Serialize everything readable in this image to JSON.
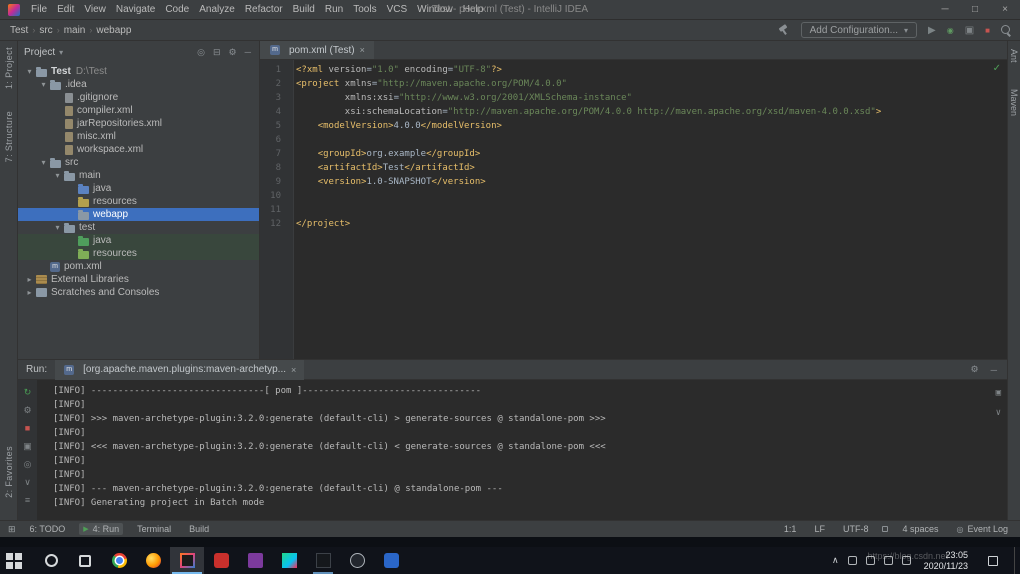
{
  "title_bar": {
    "menus": [
      "File",
      "Edit",
      "View",
      "Navigate",
      "Code",
      "Analyze",
      "Refactor",
      "Build",
      "Run",
      "Tools",
      "VCS",
      "Window",
      "Help"
    ],
    "title": "Test - pom.xml (Test) - IntelliJ IDEA"
  },
  "toolbar": {
    "breadcrumbs": [
      "Test",
      "src",
      "main",
      "webapp"
    ],
    "add_configuration": "Add Configuration..."
  },
  "left_stripe": {
    "top": [
      "1: Project",
      "7: Structure"
    ],
    "bottom": [
      "2: Favorites"
    ]
  },
  "right_stripe": {
    "top": [
      "Ant",
      "Maven"
    ]
  },
  "project_panel": {
    "header": "Project",
    "tree": [
      {
        "indent": 0,
        "chev": "down",
        "icon": "project-folder",
        "label": "Test",
        "extra": "D:\\Test",
        "bold": true
      },
      {
        "indent": 1,
        "chev": "down",
        "icon": "folder",
        "label": ".idea"
      },
      {
        "indent": 2,
        "chev": "none",
        "icon": "gitignore-file",
        "label": ".gitignore"
      },
      {
        "indent": 2,
        "chev": "none",
        "icon": "xml-file",
        "label": "compiler.xml"
      },
      {
        "indent": 2,
        "chev": "none",
        "icon": "xml-file",
        "label": "jarRepositories.xml"
      },
      {
        "indent": 2,
        "chev": "none",
        "icon": "xml-file",
        "label": "misc.xml"
      },
      {
        "indent": 2,
        "chev": "none",
        "icon": "xml-file",
        "label": "workspace.xml"
      },
      {
        "indent": 1,
        "chev": "down",
        "icon": "folder",
        "label": "src"
      },
      {
        "indent": 2,
        "chev": "down",
        "icon": "folder",
        "label": "main"
      },
      {
        "indent": 3,
        "chev": "none",
        "icon": "source-folder",
        "label": "java"
      },
      {
        "indent": 3,
        "chev": "none",
        "icon": "resources-folder",
        "label": "resources"
      },
      {
        "indent": 3,
        "chev": "none",
        "icon": "folder",
        "label": "webapp",
        "sel": "blue"
      },
      {
        "indent": 2,
        "chev": "down",
        "icon": "folder",
        "label": "test"
      },
      {
        "indent": 3,
        "chev": "none",
        "icon": "test-folder",
        "label": "java",
        "testbg": true
      },
      {
        "indent": 3,
        "chev": "none",
        "icon": "test-resources-folder",
        "label": "resources",
        "testbg": true
      },
      {
        "indent": 1,
        "chev": "none",
        "icon": "maven-file",
        "label": "pom.xml"
      },
      {
        "indent": 0,
        "chev": "right",
        "icon": "libraries",
        "label": "External Libraries"
      },
      {
        "indent": 0,
        "chev": "right",
        "icon": "scratches",
        "label": "Scratches and Consoles"
      }
    ]
  },
  "editor": {
    "tab_label": "pom.xml (Test)",
    "lines": [
      {
        "n": 1,
        "segs": [
          {
            "c": "tag",
            "t": "<?xml "
          },
          {
            "c": "attr",
            "t": "version"
          },
          {
            "c": "plain",
            "t": "="
          },
          {
            "c": "str",
            "t": "\"1.0\""
          },
          {
            "c": "plain",
            "t": " "
          },
          {
            "c": "attr",
            "t": "encoding"
          },
          {
            "c": "plain",
            "t": "="
          },
          {
            "c": "str",
            "t": "\"UTF-8\""
          },
          {
            "c": "tag",
            "t": "?>"
          }
        ]
      },
      {
        "n": 2,
        "segs": [
          {
            "c": "tag",
            "t": "<project "
          },
          {
            "c": "attr",
            "t": "xmlns"
          },
          {
            "c": "plain",
            "t": "="
          },
          {
            "c": "str",
            "t": "\"http://maven.apache.org/POM/4.0.0\""
          }
        ]
      },
      {
        "n": 3,
        "segs": [
          {
            "c": "plain",
            "t": "         "
          },
          {
            "c": "attr",
            "t": "xmlns:xsi"
          },
          {
            "c": "plain",
            "t": "="
          },
          {
            "c": "str",
            "t": "\"http://www.w3.org/2001/XMLSchema-instance\""
          }
        ]
      },
      {
        "n": 4,
        "segs": [
          {
            "c": "plain",
            "t": "         "
          },
          {
            "c": "attr",
            "t": "xsi:schemaLocation"
          },
          {
            "c": "plain",
            "t": "="
          },
          {
            "c": "str",
            "t": "\"http://maven.apache.org/POM/4.0.0 http://maven.apache.org/xsd/maven-4.0.0.xsd\""
          },
          {
            "c": "tag",
            "t": ">"
          }
        ]
      },
      {
        "n": 5,
        "segs": [
          {
            "c": "plain",
            "t": "    "
          },
          {
            "c": "tag",
            "t": "<modelVersion>"
          },
          {
            "c": "plain",
            "t": "4.0.0"
          },
          {
            "c": "tag",
            "t": "</modelVersion>"
          }
        ]
      },
      {
        "n": 6,
        "segs": []
      },
      {
        "n": 7,
        "segs": [
          {
            "c": "plain",
            "t": "    "
          },
          {
            "c": "tag",
            "t": "<groupId>"
          },
          {
            "c": "plain",
            "t": "org.example"
          },
          {
            "c": "tag",
            "t": "</groupId>"
          }
        ]
      },
      {
        "n": 8,
        "segs": [
          {
            "c": "plain",
            "t": "    "
          },
          {
            "c": "tag",
            "t": "<artifactId>"
          },
          {
            "c": "plain",
            "t": "Test"
          },
          {
            "c": "tag",
            "t": "</artifactId>"
          }
        ]
      },
      {
        "n": 9,
        "segs": [
          {
            "c": "plain",
            "t": "    "
          },
          {
            "c": "tag",
            "t": "<version>"
          },
          {
            "c": "plain",
            "t": "1.0-SNAPSHOT"
          },
          {
            "c": "tag",
            "t": "</version>"
          }
        ]
      },
      {
        "n": 10,
        "segs": []
      },
      {
        "n": 11,
        "segs": []
      },
      {
        "n": 12,
        "segs": [
          {
            "c": "tag",
            "t": "</project>"
          }
        ]
      }
    ]
  },
  "run_panel": {
    "label": "Run:",
    "tab": "[org.apache.maven.plugins:maven-archetyp...",
    "strip_icons": [
      {
        "name": "rerun-button",
        "glyph": "↻",
        "color": "#499c54"
      },
      {
        "name": "settings-button",
        "glyph": "⚙",
        "color": "#7f8487"
      },
      {
        "name": "stop-button",
        "glyph": "■",
        "color": "#c75450"
      },
      {
        "name": "restore-layout-button",
        "glyph": "▣",
        "color": "#7f8487"
      },
      {
        "name": "pin-button",
        "glyph": "◎",
        "color": "#7f8487"
      },
      {
        "name": "scroll-to-end-button",
        "glyph": "∨",
        "color": "#7f8487"
      },
      {
        "name": "clear-all-button",
        "glyph": "≡",
        "color": "#7f8487"
      }
    ],
    "console": [
      "[INFO] --------------------------------[ pom ]---------------------------------",
      "[INFO] ",
      "[INFO] >>> maven-archetype-plugin:3.2.0:generate (default-cli) > generate-sources @ standalone-pom >>>",
      "[INFO] ",
      "[INFO] <<< maven-archetype-plugin:3.2.0:generate (default-cli) < generate-sources @ standalone-pom <<<",
      "[INFO] ",
      "[INFO] ",
      "[INFO] --- maven-archetype-plugin:3.2.0:generate (default-cli) @ standalone-pom ---",
      "[INFO] Generating project in Batch mode"
    ]
  },
  "status_bar": {
    "left": [
      {
        "label": "6: TODO"
      },
      {
        "label": "4: Run",
        "icon": "run",
        "active": true
      },
      {
        "label": "Terminal"
      },
      {
        "label": "Build"
      }
    ],
    "right": [
      "1:1",
      "LF",
      "UTF-8",
      "4 spaces"
    ],
    "event_log": "Event Log"
  },
  "taskbar": {
    "apps": [
      {
        "name": "start-button",
        "kind": "start"
      },
      {
        "name": "cortana-button",
        "kind": "cortana"
      },
      {
        "name": "task-view-button",
        "kind": "taskview"
      },
      {
        "name": "chrome-app",
        "kind": "chrome"
      },
      {
        "name": "firefox-app",
        "kind": "firefox"
      },
      {
        "name": "intellij-idea-app",
        "kind": "idea",
        "focused": true
      },
      {
        "name": "red-app",
        "kind": "red"
      },
      {
        "name": "visual-studio-app",
        "kind": "vs"
      },
      {
        "name": "jetbrains-app",
        "kind": "jb"
      },
      {
        "name": "dark-app",
        "kind": "dark",
        "open": true
      },
      {
        "name": "obs-app",
        "kind": "obs"
      },
      {
        "name": "blue-app",
        "kind": "blue"
      }
    ],
    "tray": [
      {
        "name": "tray-expand-button",
        "glyph": "∧"
      },
      {
        "name": "tray-icon-1"
      },
      {
        "name": "tray-icon-2"
      },
      {
        "name": "tray-icon-3"
      },
      {
        "name": "tray-icon-4"
      }
    ],
    "time": "23:05",
    "date": "2020/11/23"
  },
  "watermark": "https://blog.csdn.net",
  "icons": {
    "minimize": "─",
    "maximize": "□",
    "close": "×",
    "chevron_down": "▾",
    "run": "▶",
    "debug": "◉",
    "profiler": "▣",
    "stop": "■",
    "gear": "⚙",
    "locate": "◎",
    "collapse": "⊟",
    "check": "✓",
    "grid": "⊞",
    "bell": "◎"
  }
}
